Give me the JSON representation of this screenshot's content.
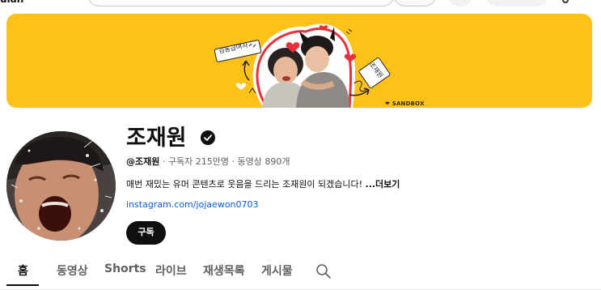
{
  "topbar": {
    "fragment": "ulan"
  },
  "banner": {
    "left_tag": "김동급여사",
    "right_tag": "조재원",
    "brand": "❤ SANDBOX",
    "background_color": "#fdc21a"
  },
  "channel": {
    "name": "조재원",
    "verified": true,
    "handle": "@조재원",
    "subscribers": "구독자 215만명",
    "videos": "동영상 890개",
    "separator": " · ",
    "description": "매번 재밌는 유머 콘텐츠로 웃음을 드리는 조재원이 되겠습니다! ",
    "more_label": "...더보기",
    "link": "instagram.com/jojaewon0703",
    "subscribe_label": "구독"
  },
  "tabs": [
    {
      "label": "홈",
      "active": true
    },
    {
      "label": "동영상",
      "active": false
    },
    {
      "label": "Shorts",
      "active": false
    },
    {
      "label": "라이브",
      "active": false
    },
    {
      "label": "재생목록",
      "active": false
    },
    {
      "label": "게시물",
      "active": false
    }
  ],
  "icons": {
    "verified": "verified-check-icon",
    "tab_search": "search-icon"
  }
}
